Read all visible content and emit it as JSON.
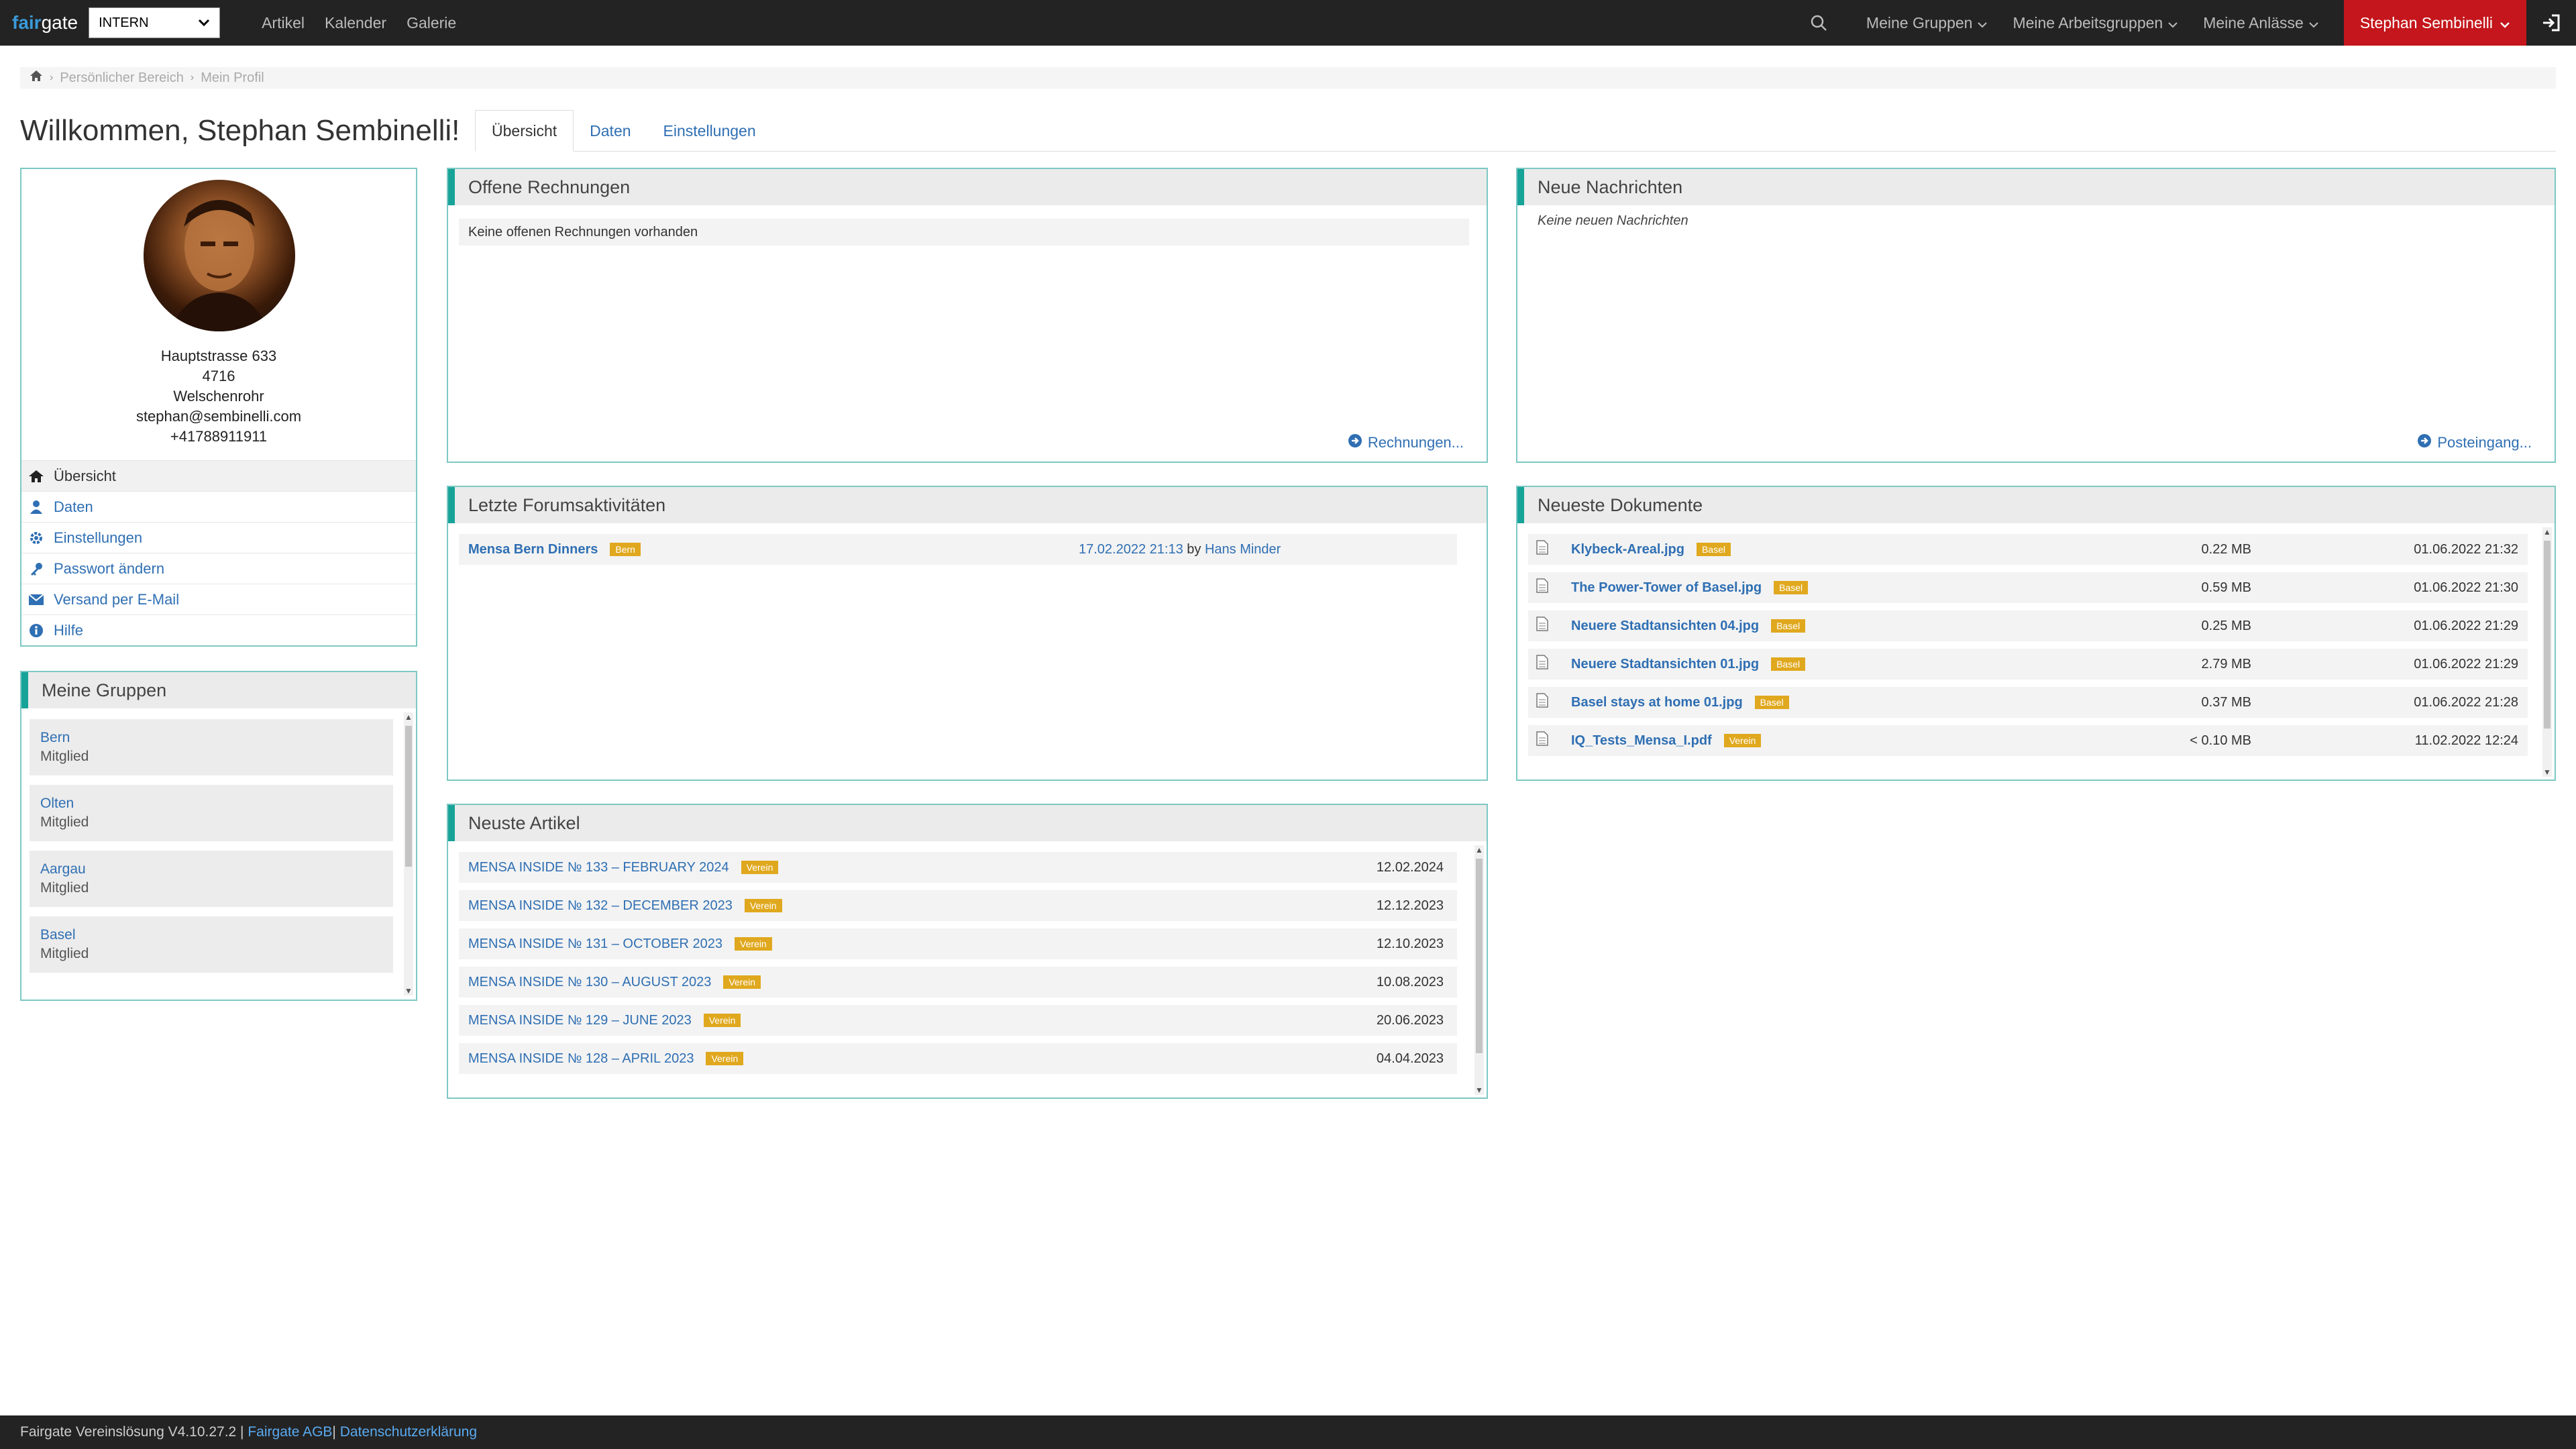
{
  "brand": {
    "part1": "fair",
    "part2": "gate"
  },
  "navbar": {
    "club_select": "INTERN",
    "links": [
      "Artikel",
      "Kalender",
      "Galerie"
    ],
    "dropdowns": [
      "Meine Gruppen",
      "Meine Arbeitsgruppen",
      "Meine Anlässe"
    ],
    "user": "Stephan Sembinelli"
  },
  "breadcrumb": [
    "Persönlicher Bereich",
    "Mein Profil"
  ],
  "page_title": "Willkommen, Stephan Sembinelli!",
  "tabs": [
    "Übersicht",
    "Daten",
    "Einstellungen"
  ],
  "profile": {
    "address": [
      "Hauptstrasse 633",
      "4716",
      "Welschenrohr",
      "stephan@sembinelli.com",
      "+41788911911"
    ],
    "menu": [
      "Übersicht",
      "Daten",
      "Einstellungen",
      "Passwort ändern",
      "Versand per E-Mail",
      "Hilfe"
    ]
  },
  "groups": {
    "title": "Meine Gruppen",
    "items": [
      {
        "name": "Bern",
        "role": "Mitglied"
      },
      {
        "name": "Olten",
        "role": "Mitglied"
      },
      {
        "name": "Aargau",
        "role": "Mitglied"
      },
      {
        "name": "Basel",
        "role": "Mitglied"
      }
    ]
  },
  "rechnungen": {
    "title": "Offene Rechnungen",
    "empty": "Keine offenen Rechnungen vorhanden",
    "link": "Rechnungen..."
  },
  "nachrichten": {
    "title": "Neue Nachrichten",
    "empty": "Keine neuen Nachrichten",
    "link": "Posteingang..."
  },
  "forum": {
    "title": "Letzte Forumsaktivitäten",
    "items": [
      {
        "topic": "Mensa Bern Dinners",
        "badge": "Bern",
        "date": "17.02.2022 21:13",
        "by": "by",
        "author": "Hans Minder"
      }
    ]
  },
  "dokumente": {
    "title": "Neueste Dokumente",
    "items": [
      {
        "name": "Klybeck-Areal.jpg",
        "badge": "Basel",
        "size": "0.22 MB",
        "date": "01.06.2022 21:32"
      },
      {
        "name": "The Power-Tower of Basel.jpg",
        "badge": "Basel",
        "size": "0.59 MB",
        "date": "01.06.2022 21:30"
      },
      {
        "name": "Neuere Stadtansichten 04.jpg",
        "badge": "Basel",
        "size": "0.25 MB",
        "date": "01.06.2022 21:29"
      },
      {
        "name": "Neuere Stadtansichten 01.jpg",
        "badge": "Basel",
        "size": "2.79 MB",
        "date": "01.06.2022 21:29"
      },
      {
        "name": "Basel stays at home 01.jpg",
        "badge": "Basel",
        "size": "0.37 MB",
        "date": "01.06.2022 21:28"
      },
      {
        "name": "IQ_Tests_Mensa_I.pdf",
        "badge": "Verein",
        "size": "< 0.10 MB",
        "date": "11.02.2022 12:24"
      }
    ]
  },
  "artikel": {
    "title": "Neuste Artikel",
    "items": [
      {
        "name": "MENSA INSIDE № 133 – FEBRUARY 2024",
        "badge": "Verein",
        "date": "12.02.2024"
      },
      {
        "name": "MENSA INSIDE № 132 – DECEMBER 2023",
        "badge": "Verein",
        "date": "12.12.2023"
      },
      {
        "name": "MENSA INSIDE № 131 – OCTOBER 2023",
        "badge": "Verein",
        "date": "12.10.2023"
      },
      {
        "name": "MENSA INSIDE № 130 – AUGUST 2023",
        "badge": "Verein",
        "date": "10.08.2023"
      },
      {
        "name": "MENSA INSIDE № 129 – JUNE 2023",
        "badge": "Verein",
        "date": "20.06.2023"
      },
      {
        "name": "MENSA INSIDE № 128 – APRIL 2023",
        "badge": "Verein",
        "date": "04.04.2023"
      }
    ]
  },
  "footer": {
    "text": "Fairgate Vereinslösung V4.10.27.2 |",
    "agb": "Fairgate AGB",
    "sep": "|",
    "privacy": "Datenschutzerklärung"
  },
  "colors": {
    "accent": "#17a398",
    "brand_red": "#c4161c",
    "link": "#2f6fb3",
    "badge": "#e0a81e",
    "navbar": "#232323"
  }
}
